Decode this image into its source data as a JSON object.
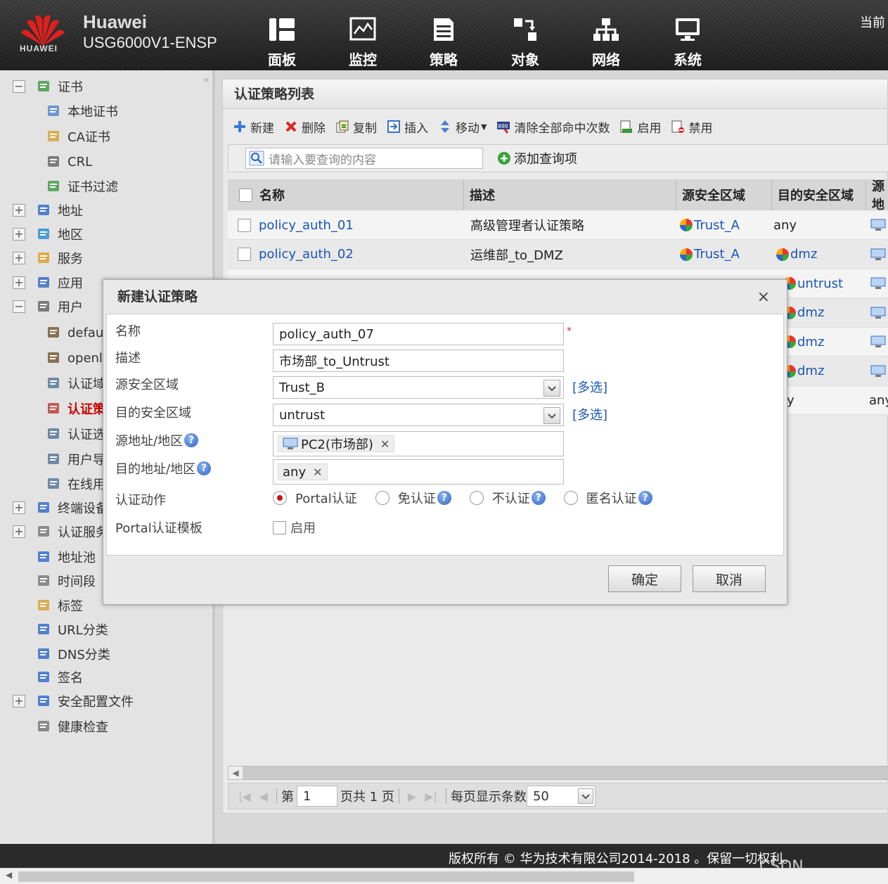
{
  "header": {
    "brand": "Huawei",
    "logo_text": "HUAWEI",
    "model": "USG6000V1-ENSP",
    "current": "当前",
    "nav": [
      {
        "label": "面板",
        "icon": "dashboard-icon"
      },
      {
        "label": "监控",
        "icon": "monitor-chart-icon"
      },
      {
        "label": "策略",
        "icon": "policy-document-icon"
      },
      {
        "label": "对象",
        "icon": "object-icon"
      },
      {
        "label": "网络",
        "icon": "network-icon"
      },
      {
        "label": "系统",
        "icon": "system-monitor-icon"
      }
    ]
  },
  "sidebar": {
    "items": [
      {
        "label": "证书",
        "expander": "−"
      },
      {
        "label": "本地证书"
      },
      {
        "label": "CA证书"
      },
      {
        "label": "CRL"
      },
      {
        "label": "证书过滤"
      },
      {
        "label": "地址",
        "expander": "+"
      },
      {
        "label": "地区",
        "expander": "+"
      },
      {
        "label": "服务",
        "expander": "+"
      },
      {
        "label": "应用",
        "expander": "+"
      },
      {
        "label": "用户",
        "expander": "−"
      },
      {
        "label": "defaul"
      },
      {
        "label": "openla"
      },
      {
        "label": "认证域"
      },
      {
        "label": "认证策"
      },
      {
        "label": "认证选"
      },
      {
        "label": "用户导"
      },
      {
        "label": "在线用"
      },
      {
        "label": "终端设备",
        "expander": "+"
      },
      {
        "label": "认证服务",
        "expander": "+"
      },
      {
        "label": "地址池"
      },
      {
        "label": "时间段"
      },
      {
        "label": "标签"
      },
      {
        "label": "URL分类"
      },
      {
        "label": "DNS分类"
      },
      {
        "label": "签名"
      },
      {
        "label": "安全配置文件",
        "expander": "+"
      },
      {
        "label": "健康检查"
      }
    ]
  },
  "main": {
    "title": "认证策略列表",
    "toolbar": {
      "new": "新建",
      "delete": "删除",
      "copy": "复制",
      "insert": "插入",
      "move": "移动",
      "clear_hits": "清除全部命中次数",
      "enable": "启用",
      "disable": "禁用"
    },
    "search": {
      "placeholder": "请输入要查询的内容",
      "add_query": "添加查询项"
    },
    "columns": [
      "名称",
      "描述",
      "源安全区域",
      "目的安全区域",
      "源地"
    ],
    "rows": [
      {
        "name": "policy_auth_01",
        "desc": "高级管理者认证策略",
        "src": "Trust_A",
        "dst": "any"
      },
      {
        "name": "policy_auth_02",
        "desc": "运维部_to_DMZ",
        "src": "Trust_A",
        "dst": "dmz"
      },
      {
        "name": "",
        "desc": "",
        "src": "",
        "dst": "untrust"
      },
      {
        "name": "",
        "desc": "",
        "src": "",
        "dst": "dmz"
      },
      {
        "name": "",
        "desc": "",
        "src": "",
        "dst": "dmz"
      },
      {
        "name": "",
        "desc": "",
        "src": "",
        "dst": "dmz"
      },
      {
        "name": "",
        "desc": "",
        "src": "",
        "dst": "y",
        "extra": "any"
      }
    ],
    "pager": {
      "page_prefix": "第",
      "page_value": "1",
      "page_suffix": "页共 1 页",
      "per_page_label": "每页显示条数",
      "per_page_value": "50"
    }
  },
  "dialog": {
    "title": "新建认证策略",
    "close": "×",
    "fields": {
      "name_label": "名称",
      "name_value": "policy_auth_07",
      "required_mark": "*",
      "desc_label": "描述",
      "desc_value": "市场部_to_Untrust",
      "src_zone_label": "源安全区域",
      "src_zone_value": "Trust_B",
      "dst_zone_label": "目的安全区域",
      "dst_zone_value": "untrust",
      "multi_select": "[多选]",
      "src_addr_label": "源地址/地区",
      "src_addr_tag": "PC2(市场部)",
      "dst_addr_label": "目的地址/地区",
      "dst_addr_tag": "any",
      "action_label": "认证动作",
      "action_options": [
        "Portal认证",
        "免认证",
        "不认证",
        "匿名认证"
      ],
      "action_selected": 0,
      "portal_label": "Portal认证模板",
      "portal_enable": "启用"
    },
    "ok": "确定",
    "cancel": "取消"
  },
  "footer": {
    "copyright": "版权所有 © 华为技术有限公司2014-2018 。保留一切权利。",
    "watermark": "CSDN @quencep"
  },
  "colors": {
    "accent_link": "#1a55b8",
    "required": "#e22222",
    "brand_red": "#e0201e"
  }
}
